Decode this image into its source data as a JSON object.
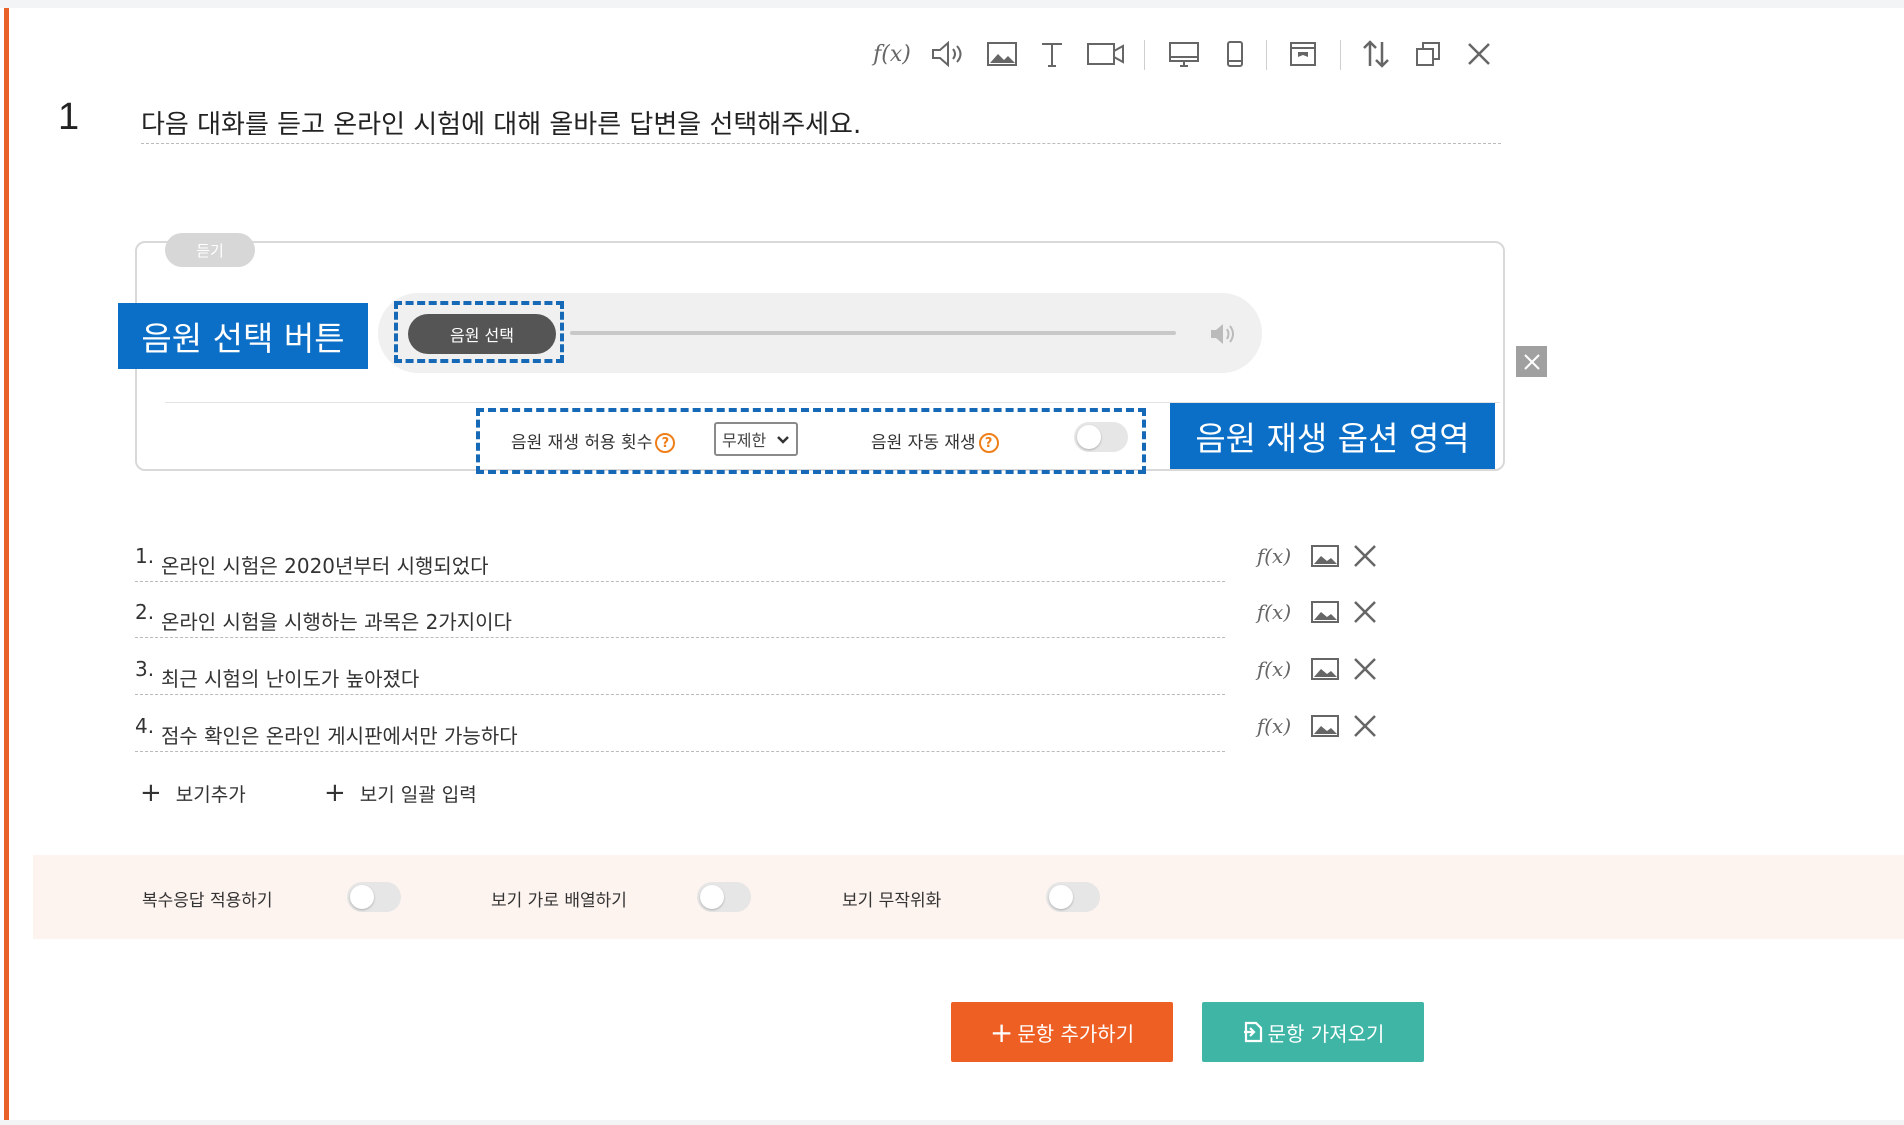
{
  "toolbar": {
    "formula_icon": "f(x)",
    "icons": [
      "formula-icon",
      "audio-icon",
      "image-icon",
      "text-icon",
      "video-icon",
      "desktop-icon",
      "mobile-icon",
      "layout-icon",
      "reorder-icon",
      "copy-icon",
      "close-icon"
    ]
  },
  "question": {
    "number": "1",
    "text": "다음 대화를 듣고 온라인 시험에 대해 올바른 답변을 선택해주세요."
  },
  "listen": {
    "tag": "듣기",
    "choose_button": "음원 선택",
    "callout_button": "음원 선택 버튼",
    "play_count_label": "음원 재생 허용 횟수",
    "play_count_value": "무제한",
    "autoplay_label": "음원 자동 재생",
    "help_glyph": "?",
    "callout_options": "음원 재생 옵션 영역"
  },
  "options": [
    {
      "num": "1.",
      "text": "온라인 시험은 2020년부터 시행되었다"
    },
    {
      "num": "2.",
      "text": "온라인 시험을 시행하는 과목은 2가지이다"
    },
    {
      "num": "3.",
      "text": "최근 시험의 난이도가 높아졌다"
    },
    {
      "num": "4.",
      "text": "점수 확인은 온라인 게시판에서만 가능하다"
    }
  ],
  "add_links": {
    "add_option": "보기추가",
    "bulk_input": "보기 일괄 입력"
  },
  "settings": {
    "multiple_answers": "복수응답 적용하기",
    "horizontal_layout": "보기 가로 배열하기",
    "shuffle": "보기 무작위화"
  },
  "buttons": {
    "add_question": "문항 추가하기",
    "import_question": "문항 가져오기"
  },
  "colors": {
    "accent_orange": "#ee5f24",
    "accent_teal": "#3fb5a6",
    "callout_blue": "#0c6fc7"
  }
}
